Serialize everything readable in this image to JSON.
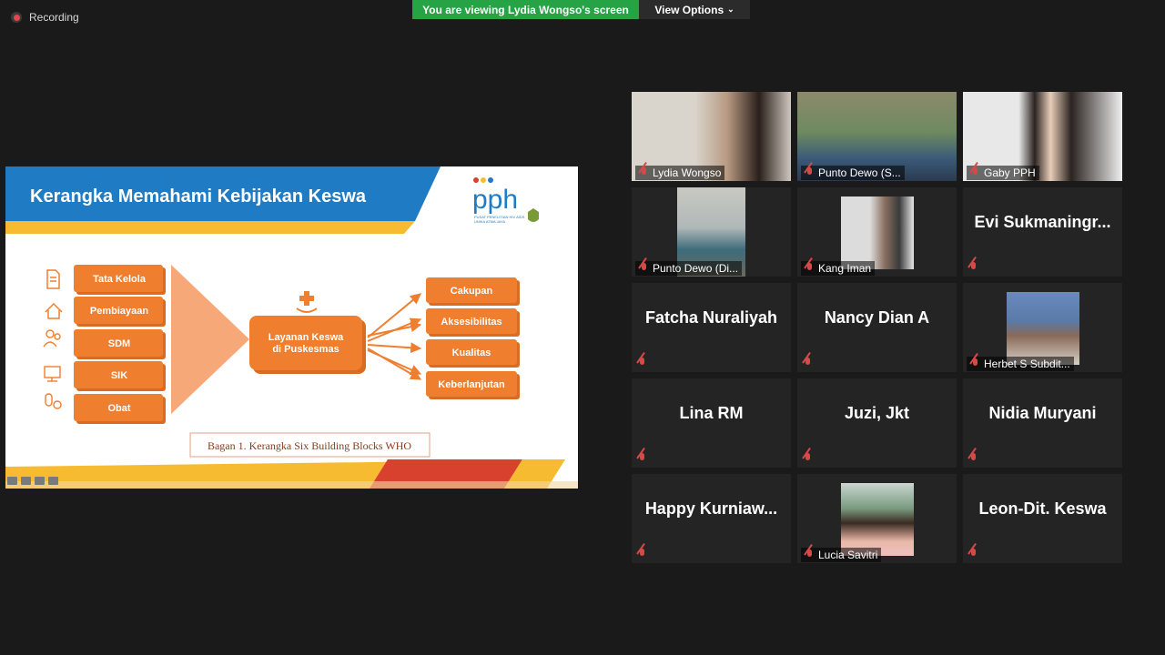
{
  "top_bar": {
    "recording_label": "Recording",
    "viewing_label": "You are viewing Lydia Wongso's screen",
    "view_options_label": "View Options"
  },
  "slide": {
    "title": "Kerangka Memahami Kebijakan Keswa",
    "logo_text": "pph",
    "logo_subtext_1": "PUSAT PENELITIAN HIV AIDS",
    "logo_subtext_2": "UNIKA ATMA JAYA",
    "left_blocks": [
      "Tata Kelola",
      "Pembiayaan",
      "SDM",
      "SIK",
      "Obat"
    ],
    "left_icons": [
      "document-icon",
      "home-icon",
      "people-icon",
      "monitor-icon",
      "pills-icon"
    ],
    "center_label_1": "Layanan Keswa",
    "center_label_2": "di Puskesmas",
    "right_blocks": [
      "Cakupan",
      "Aksesibilitas",
      "Kualitas",
      "Keberlanjutan"
    ],
    "caption": "Bagan 1.  Kerangka Six Building Blocks WHO",
    "colors": {
      "orange": "#ef7e2e",
      "blue": "#1f7bc4",
      "yellow": "#f7bb32",
      "red": "#d8412e"
    }
  },
  "participants": [
    {
      "name": "Lydia Wongso",
      "video": true
    },
    {
      "name": "Punto Dewo (S...",
      "video": true
    },
    {
      "name": "Gaby PPH",
      "video": true
    },
    {
      "name": "Punto Dewo (Di...",
      "video": true
    },
    {
      "name": "Kang Iman",
      "video": true
    },
    {
      "name": "Evi  Sukmaningr...",
      "video": false
    },
    {
      "name": "Fatcha Nuraliyah",
      "video": false
    },
    {
      "name": "Nancy Dian A",
      "video": false
    },
    {
      "name": "Herbet S Subdit...",
      "video": true
    },
    {
      "name": "Lina RM",
      "video": false
    },
    {
      "name": "Juzi, Jkt",
      "video": false
    },
    {
      "name": "Nidia Muryani",
      "video": false
    },
    {
      "name": "Happy  Kurniaw...",
      "video": false
    },
    {
      "name": "Lucia Savitri",
      "video": true
    },
    {
      "name": "Leon-Dit. Keswa",
      "video": false
    }
  ]
}
